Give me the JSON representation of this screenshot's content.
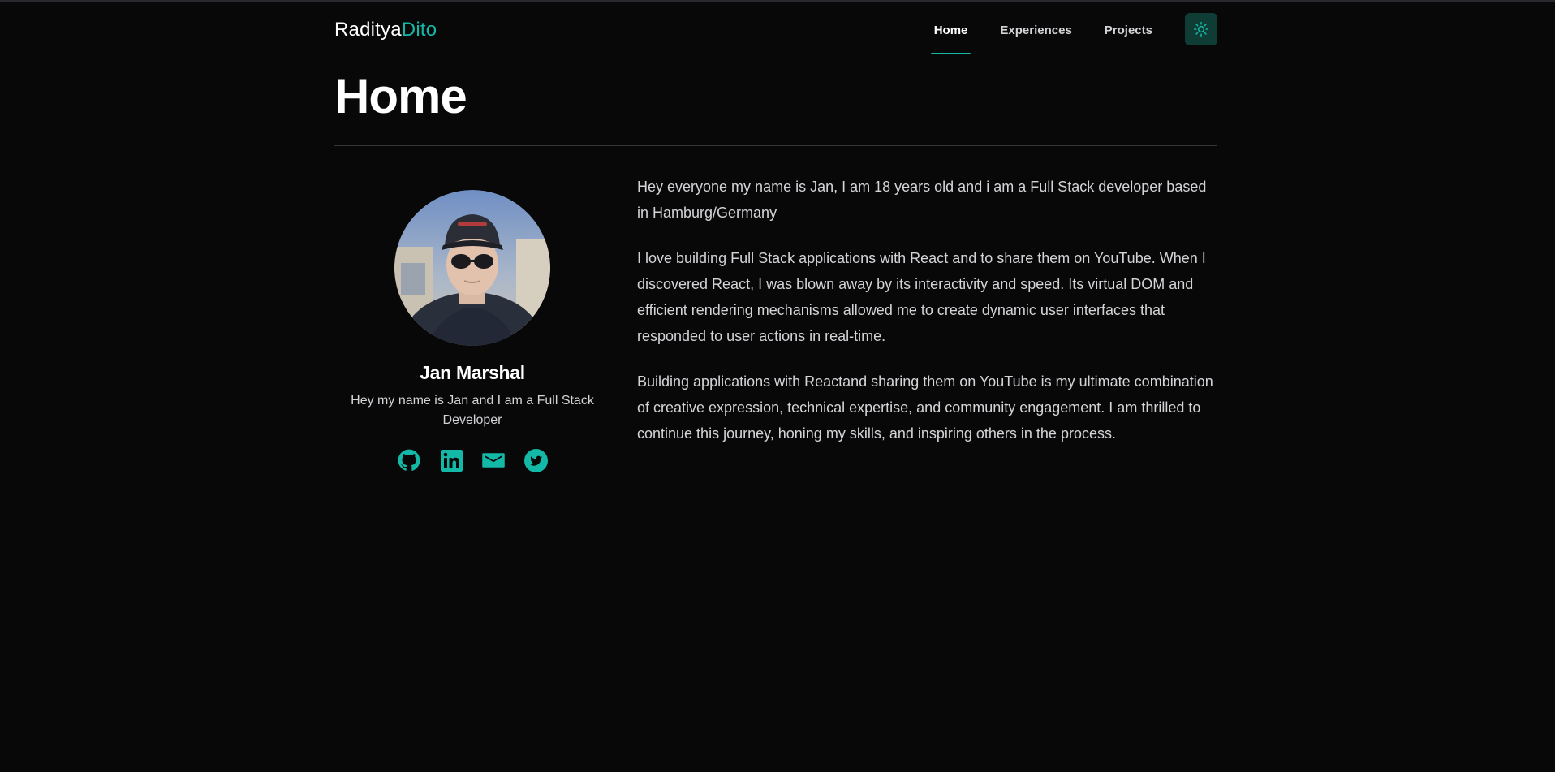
{
  "header": {
    "brand_first": "Raditya",
    "brand_second": "Dito",
    "nav": [
      {
        "label": "Home",
        "active": true
      },
      {
        "label": "Experiences",
        "active": false
      },
      {
        "label": "Projects",
        "active": false
      }
    ],
    "theme_toggle_icon": "sun-icon"
  },
  "page": {
    "title": "Home"
  },
  "profile": {
    "name": "Jan Marshal",
    "tagline": "Hey my name is Jan and I am a Full Stack Developer",
    "socials": [
      {
        "icon": "github-icon"
      },
      {
        "icon": "linkedin-icon"
      },
      {
        "icon": "mail-icon"
      },
      {
        "icon": "twitter-icon"
      }
    ]
  },
  "bio": {
    "paragraphs": [
      "Hey everyone my name is Jan, I am 18 years old and i am a Full Stack developer based in Hamburg/Germany",
      "I love building Full Stack applications with React and to share them on YouTube. When I discovered React, I was blown away by its interactivity and speed. Its virtual DOM and efficient rendering mechanisms allowed me to create dynamic user interfaces that responded to user actions in real-time.",
      "Building applications with Reactand sharing them on YouTube is my ultimate combination of creative expression, technical expertise, and community engagement. I am thrilled to continue this journey, honing my skills, and inspiring others in the process."
    ]
  },
  "colors": {
    "background": "#080808",
    "accent": "#14b8a6",
    "theme_button_bg": "#0f3d36",
    "text_primary": "#ffffff",
    "text_secondary": "#d4d4d8",
    "divider": "#34343a"
  }
}
